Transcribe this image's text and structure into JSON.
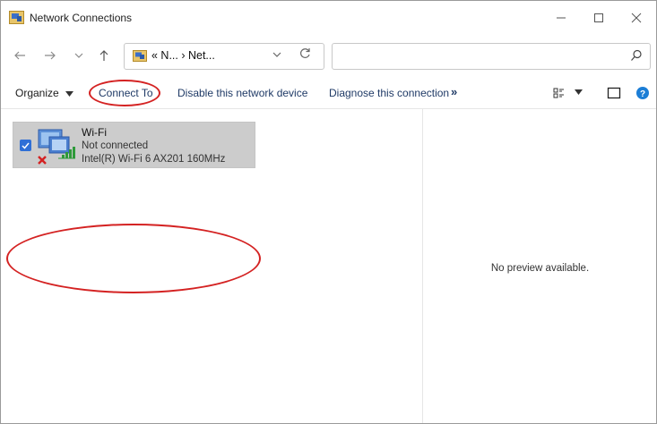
{
  "window": {
    "title": "Network Connections"
  },
  "address": {
    "path": "« N... › Net..."
  },
  "search": {
    "placeholder": ""
  },
  "toolbar": {
    "organize": "Organize",
    "connect_to": "Connect To",
    "disable": "Disable this network device",
    "diagnose": "Diagnose this connection",
    "more": "»"
  },
  "connection": {
    "name": "Wi-Fi",
    "status": "Not connected",
    "device": "Intel(R) Wi-Fi 6 AX201 160MHz",
    "selected": true
  },
  "preview": {
    "message": "No preview available."
  },
  "colors": {
    "annotation": "#d42222",
    "selection": "#cccccc",
    "checkbox": "#2f6fd6",
    "help": "#1c7ed6",
    "command_text": "#1f3a66"
  }
}
